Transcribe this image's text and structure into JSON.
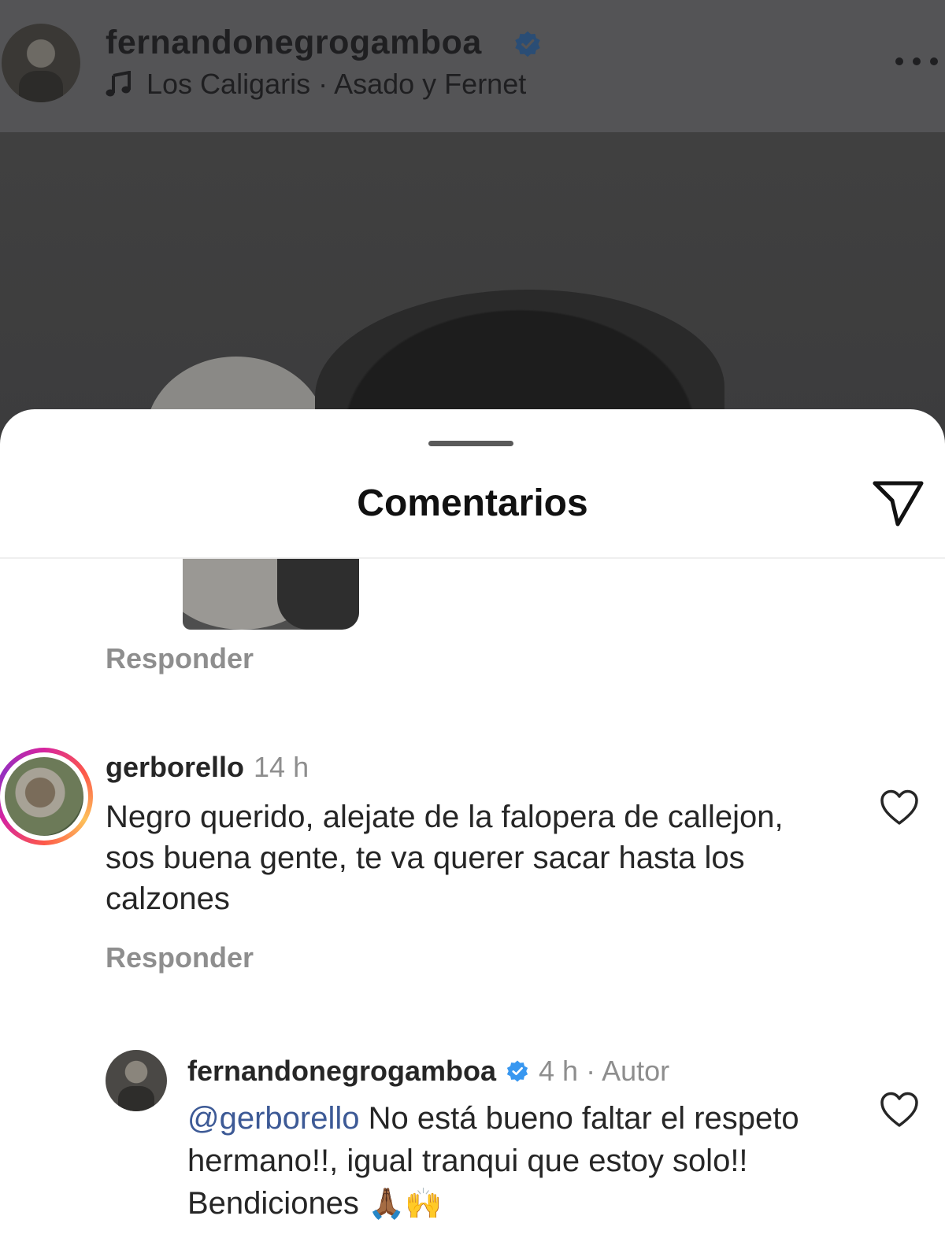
{
  "post": {
    "username": "fernandonegrogamboa",
    "song": "Los Caligaris · Asado y Fernet"
  },
  "sheet": {
    "title": "Comentarios"
  },
  "comments": [
    {
      "reply_label": "Responder"
    },
    {
      "username": "gerborello",
      "time": "14 h",
      "text": "Negro querido, alejate de la falopera de callejon, sos buena gente, te va querer sacar hasta los calzones",
      "reply_label": "Responder"
    }
  ],
  "reply": {
    "username": "fernandonegrogamboa",
    "meta": "4 h · Autor",
    "mention": "@gerborello",
    "text": " No está bueno faltar el respeto hermano!!, igual tranqui que estoy solo!! Bendiciones ",
    "emojis": "🙏🏾🙌"
  },
  "colors": {
    "verified": "#3897f0",
    "mention": "#3d5a96",
    "secondary_text": "#8e8e8e"
  },
  "icons": [
    "verified-badge-icon",
    "music-note-icon",
    "more-options-icon",
    "share-send-icon",
    "heart-icon"
  ]
}
